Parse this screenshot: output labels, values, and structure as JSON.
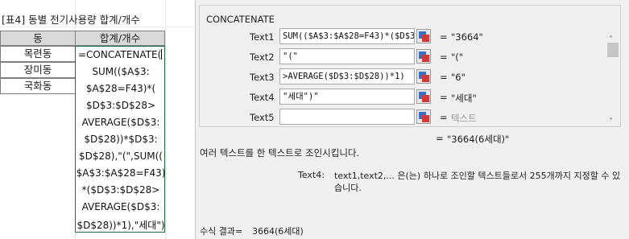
{
  "sheet": {
    "title": "[표4] 동별 전기사용량 합계/개수",
    "header_col1": "동",
    "header_col2": "합계/개수",
    "rows": [
      "목련동",
      "장미동",
      "국화동"
    ],
    "editing_lines": [
      "=CONCATENATE(",
      "SUM(($A$3:",
      "$A$28=F43)*(",
      "$D$3:$D$28>",
      "AVERAGE($D$3:",
      "$D$28))*$D$3:",
      "$D$28),\"(\",SUM((",
      "$A$3:$A$28=F43)",
      "*($D$3:$D$28>",
      "AVERAGE($D$3:",
      "$D$28))*1),\"세대\")"
    ]
  },
  "dialog": {
    "function_name": "CONCATENATE",
    "args": [
      {
        "label": "Text1",
        "input": "SUM(($A$3:$A$28=F43)*($D$3:$D",
        "value": "\"3664\""
      },
      {
        "label": "Text2",
        "input": "\"(\"",
        "value": "\"(\""
      },
      {
        "label": "Text3",
        "input": ">AVERAGE($D$3:$D$28))*1)",
        "value": "\"6\""
      },
      {
        "label": "Text4",
        "input": "\"세대\")\"",
        "value": "\"세대\""
      },
      {
        "label": "Text5",
        "input": "",
        "value": "텍스트"
      }
    ],
    "eq": "=",
    "result_value": "\"3664(6세대)\"",
    "description": "여러 텍스트를 한 텍스트로 조인시킵니다.",
    "arg_help_label": "Text4:",
    "arg_help_text": "text1,text2,... 은(는) 하나로 조인할 텍스트들로서 255개까지 지정할 수 있습니다.",
    "formula_result_label": "수식 결과=",
    "formula_result_value": "3664(6세대)",
    "scroll_up_glyph": "˄",
    "scroll_down_glyph": "˅"
  },
  "colors": {
    "header_fill": "#d9d9d9",
    "active_cell_border": "#1e7145",
    "dialog_bg": "#f0f0f0"
  }
}
